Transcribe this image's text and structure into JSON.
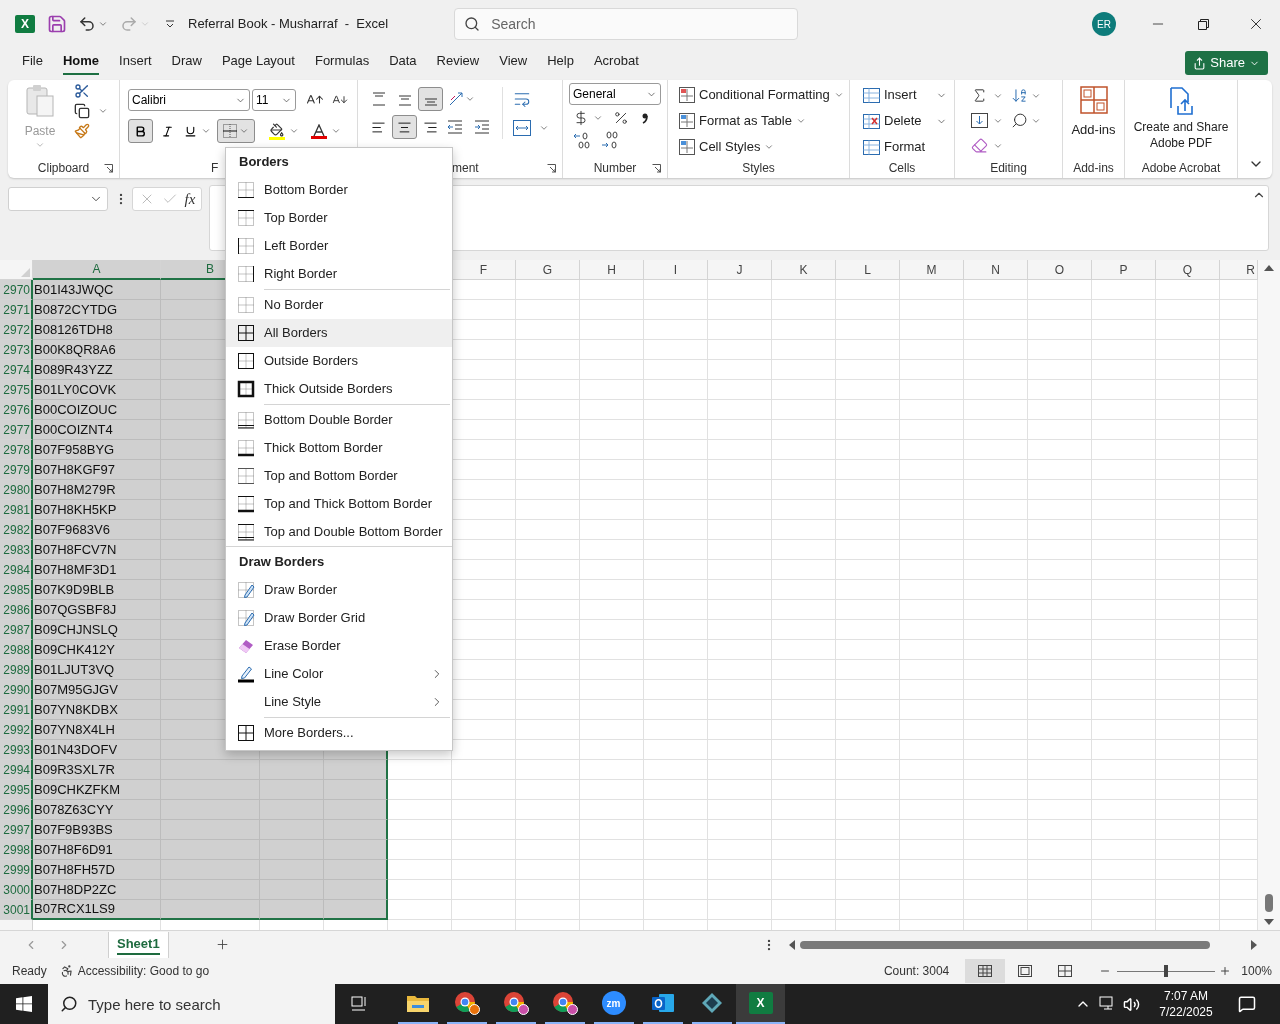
{
  "title_bar": {
    "logo": "X",
    "title": "Referral Book - Musharraf  -  Excel",
    "search": {
      "placeholder": "Search"
    },
    "avatar": "ER"
  },
  "ribbon_tabs": [
    {
      "label": "File",
      "selected": false
    },
    {
      "label": "Home",
      "selected": true
    },
    {
      "label": "Insert",
      "selected": false
    },
    {
      "label": "Draw",
      "selected": false
    },
    {
      "label": "Page Layout",
      "selected": false
    },
    {
      "label": "Formulas",
      "selected": false
    },
    {
      "label": "Data",
      "selected": false
    },
    {
      "label": "Review",
      "selected": false
    },
    {
      "label": "View",
      "selected": false
    },
    {
      "label": "Help",
      "selected": false
    },
    {
      "label": "Acrobat",
      "selected": false
    }
  ],
  "share_button": "Share",
  "ribbon": {
    "clipboard": {
      "paste": "Paste",
      "label": "Clipboard"
    },
    "font": {
      "font_name": "Calibri",
      "font_size": "11",
      "bold": true,
      "borders_open": true,
      "label": "F"
    },
    "alignment": {
      "vertical": [
        {
          "selected": false
        },
        {
          "selected": false
        },
        {
          "selected": true
        }
      ],
      "horizontal": [
        {
          "selected": false
        },
        {
          "selected": true
        },
        {
          "selected": false
        }
      ],
      "label": "ment"
    },
    "number": {
      "format": "General",
      "label": "Number"
    },
    "styles": {
      "items": [
        "Conditional Formatting",
        "Format as Table",
        "Cell Styles"
      ],
      "label": "Styles"
    },
    "cells": {
      "items": [
        "Insert",
        "Delete",
        "Format"
      ],
      "label": "Cells"
    },
    "editing": {
      "label": "Editing"
    },
    "add_ins": {
      "button": "Add-ins",
      "label": "Add-ins"
    },
    "acrobat": {
      "button": "Create and Share Adobe PDF",
      "label": "Adobe Acrobat"
    }
  },
  "formula_bar": {
    "fx": "fx"
  },
  "grid": {
    "columns": [
      {
        "label": "A",
        "selected": true
      },
      {
        "label": "B",
        "selected": true
      },
      {
        "selected": true
      },
      {
        "selected": true
      },
      {
        "selected": false
      },
      {
        "label": "F",
        "selected": false
      },
      {
        "label": "G",
        "selected": false
      },
      {
        "label": "H",
        "selected": false
      },
      {
        "label": "I",
        "selected": false
      },
      {
        "label": "J",
        "selected": false
      },
      {
        "label": "K",
        "selected": false
      },
      {
        "label": "L",
        "selected": false
      },
      {
        "label": "M",
        "selected": false
      },
      {
        "label": "N",
        "selected": false
      },
      {
        "label": "O",
        "selected": false
      },
      {
        "label": "P",
        "selected": false
      },
      {
        "label": "Q",
        "selected": false
      },
      {
        "label": "R",
        "selected": false
      }
    ],
    "rows": [
      {
        "number": "2970",
        "value": "B01I43JWQC",
        "selected": true
      },
      {
        "number": "2971",
        "value": "B0872CYTDG",
        "selected": true
      },
      {
        "number": "2972",
        "value": "B08126TDH8",
        "selected": true
      },
      {
        "number": "2973",
        "value": "B00K8QR8A6",
        "selected": true
      },
      {
        "number": "2974",
        "value": "B089R43YZZ",
        "selected": true
      },
      {
        "number": "2975",
        "value": "B01LY0COVK",
        "selected": true
      },
      {
        "number": "2976",
        "value": "B00COIZOUC",
        "selected": true
      },
      {
        "number": "2977",
        "value": "B00COIZNT4",
        "selected": true
      },
      {
        "number": "2978",
        "value": "B07F958BYG",
        "selected": true
      },
      {
        "number": "2979",
        "value": "B07H8KGF97",
        "selected": true
      },
      {
        "number": "2980",
        "value": "B07H8M279R",
        "selected": true
      },
      {
        "number": "2981",
        "value": "B07H8KH5KP",
        "selected": true
      },
      {
        "number": "2982",
        "value": "B07F9683V6",
        "selected": true
      },
      {
        "number": "2983",
        "value": "B07H8FCV7N",
        "selected": true
      },
      {
        "number": "2984",
        "value": "B07H8MF3D1",
        "selected": true
      },
      {
        "number": "2985",
        "value": "B07K9D9BLB",
        "selected": true
      },
      {
        "number": "2986",
        "value": "B07QGSBF8J",
        "selected": true
      },
      {
        "number": "2987",
        "value": "B09CHJNSLQ",
        "selected": true
      },
      {
        "number": "2988",
        "value": "B09CHK412Y",
        "selected": true
      },
      {
        "number": "2989",
        "value": "B01LJUT3VQ",
        "selected": true
      },
      {
        "number": "2990",
        "value": "B07M95GJGV",
        "selected": true
      },
      {
        "number": "2991",
        "value": "B07YN8KDBX",
        "selected": true
      },
      {
        "number": "2992",
        "value": "B07YN8X4LH",
        "selected": true
      },
      {
        "number": "2993",
        "value": "B01N43DOFV",
        "selected": true
      },
      {
        "number": "2994",
        "value": "B09R3SXL7R",
        "selected": true
      },
      {
        "number": "2995",
        "value": "B09CHKZFKM",
        "selected": true
      },
      {
        "number": "2996",
        "value": "B078Z63CYY",
        "selected": true
      },
      {
        "number": "2997",
        "value": "B07F9B93BS",
        "selected": true
      },
      {
        "number": "2998",
        "value": "B07H8F6D91",
        "selected": true
      },
      {
        "number": "2999",
        "value": "B07H8FH57D",
        "selected": true
      },
      {
        "number": "3000",
        "value": "B07H8DP2ZC",
        "selected": true
      },
      {
        "number": "3001",
        "value": "B07RCX1LS9",
        "selected": true
      }
    ]
  },
  "borders_menu": {
    "sections": [
      {
        "title": "Borders",
        "groups": [
          [
            {
              "label": "Bottom Border",
              "hovered": false,
              "submenu": false
            },
            {
              "label": "Top Border",
              "hovered": false,
              "submenu": false
            },
            {
              "label": "Left Border",
              "hovered": false,
              "submenu": false
            },
            {
              "label": "Right Border",
              "hovered": false,
              "submenu": false
            }
          ],
          [
            {
              "label": "No Border",
              "hovered": false,
              "submenu": false
            },
            {
              "label": "All Borders",
              "hovered": true,
              "submenu": false
            },
            {
              "label": "Outside Borders",
              "hovered": false,
              "submenu": false
            },
            {
              "label": "Thick Outside Borders",
              "hovered": false,
              "submenu": false
            }
          ],
          [
            {
              "label": "Bottom Double Border",
              "hovered": false,
              "submenu": false
            },
            {
              "label": "Thick Bottom Border",
              "hovered": false,
              "submenu": false
            },
            {
              "label": "Top and Bottom Border",
              "hovered": false,
              "submenu": false
            },
            {
              "label": "Top and Thick Bottom Border",
              "hovered": false,
              "submenu": false
            },
            {
              "label": "Top and Double Bottom Border",
              "hovered": false,
              "submenu": false
            }
          ]
        ]
      },
      {
        "title": "Draw Borders",
        "groups": [
          [
            {
              "label": "Draw Border",
              "hovered": false,
              "submenu": false
            },
            {
              "label": "Draw Border Grid",
              "hovered": false,
              "submenu": false
            },
            {
              "label": "Erase Border",
              "hovered": false,
              "submenu": false
            },
            {
              "label": "Line Color",
              "hovered": false,
              "submenu": true
            },
            {
              "label": "Line Style",
              "hovered": false,
              "submenu": true
            }
          ],
          [
            {
              "label": "More Borders...",
              "hovered": false,
              "submenu": false
            }
          ]
        ]
      }
    ]
  },
  "sheet_tabs": [
    {
      "label": "Sheet1",
      "selected": true
    }
  ],
  "status_bar": {
    "status": "Ready",
    "accessibility": "Accessibility: Good to go",
    "count": "Count: 3004",
    "views": [
      {
        "selected": true
      },
      {
        "selected": false
      },
      {
        "selected": false
      }
    ],
    "zoom": {
      "level": 0.5,
      "reading": "100%"
    }
  },
  "taskbar": {
    "search": {
      "placeholder": "Type here to search"
    },
    "apps": [
      {
        "kind": "folder",
        "running": true,
        "selected": false
      },
      {
        "kind": "browser",
        "color": "#e8710a",
        "running": true,
        "selected": false
      },
      {
        "kind": "browser",
        "color": "#c94fa8",
        "running": true,
        "selected": false
      },
      {
        "kind": "browser",
        "color": "#c94fa8",
        "running": true,
        "selected": false
      },
      {
        "kind": "meeting",
        "label": "zm",
        "running": true,
        "selected": false
      },
      {
        "kind": "mail",
        "running": true,
        "selected": false
      },
      {
        "kind": "diamond",
        "running": true,
        "selected": false
      },
      {
        "kind": "sheet",
        "label": "X",
        "running": true,
        "selected": true
      }
    ],
    "time": "7:07 AM",
    "date": "7/22/2025"
  }
}
